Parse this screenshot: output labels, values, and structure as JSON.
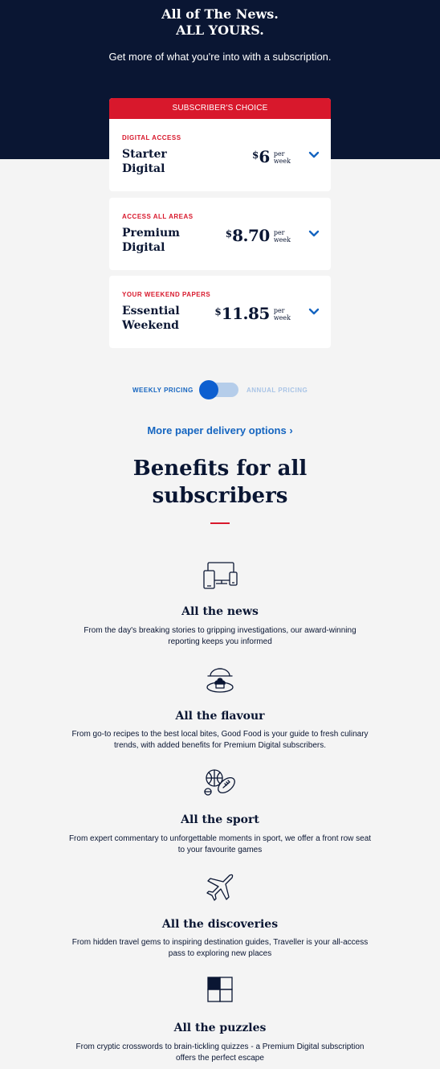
{
  "hero": {
    "title_line1": "All of The News.",
    "title_line2": "ALL YOURS.",
    "subtitle": "Get more of what you're into with a subscription."
  },
  "plans": [
    {
      "banner": "SUBSCRIBER'S CHOICE",
      "tag": "DIGITAL ACCESS",
      "name": "Starter Digital",
      "currency": "$",
      "price": "6",
      "per_line1": "per",
      "per_line2": "week"
    },
    {
      "tag": "ACCESS ALL AREAS",
      "name": "Premium Digital",
      "currency": "$",
      "price": "8.70",
      "per_line1": "per",
      "per_line2": "week"
    },
    {
      "tag": "YOUR WEEKEND PAPERS",
      "name": "Essential Weekend",
      "currency": "$",
      "price": "11.85",
      "per_line1": "per",
      "per_line2": "week"
    }
  ],
  "pricing_toggle": {
    "weekly_label": "WEEKLY PRICING",
    "annual_label": "ANNUAL PRICING",
    "selected": "weekly"
  },
  "more_link": "More paper delivery options ›",
  "benefits": {
    "title": "Benefits for all subscribers",
    "items": [
      {
        "icon": "devices-icon",
        "title": "All the news",
        "desc": "From the day's breaking stories to gripping investigations, our award-winning reporting keeps you informed"
      },
      {
        "icon": "cloche-icon",
        "title": "All the flavour",
        "desc": "From go-to recipes to the best local bites, Good Food is your guide to fresh culinary trends, with added benefits for Premium Digital subscribers."
      },
      {
        "icon": "sports-balls-icon",
        "title": "All the sport",
        "desc": "From expert commentary to unforgettable moments in sport, we offer a front row seat to your favourite games"
      },
      {
        "icon": "airplane-icon",
        "title": "All the discoveries",
        "desc": "From hidden travel gems to inspiring destination guides, Traveller is your all-access pass to exploring new places"
      },
      {
        "icon": "crossword-icon",
        "title": "All the puzzles",
        "desc": "From cryptic crosswords to brain-tickling quizzes - a Premium Digital subscription offers the perfect escape"
      }
    ]
  },
  "colors": {
    "navy": "#0a1633",
    "red": "#d8182c",
    "blue": "#1565c0",
    "background": "#f4f4f4"
  }
}
